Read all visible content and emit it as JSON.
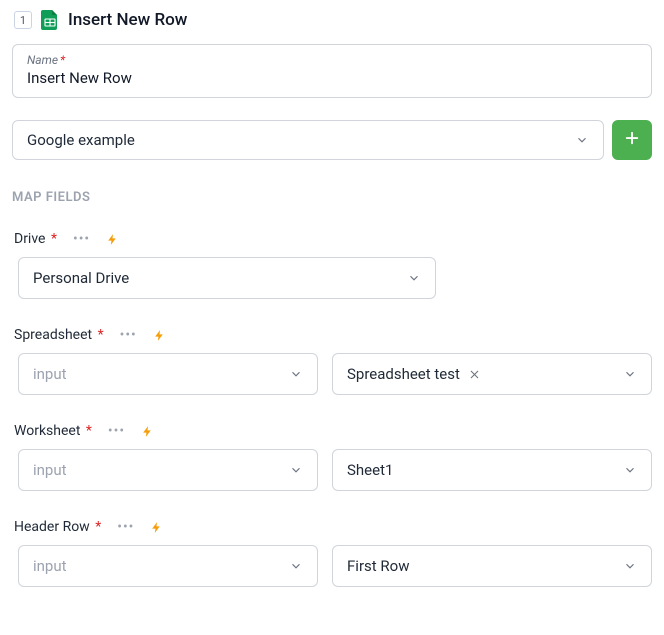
{
  "header": {
    "step_number": "1",
    "title": "Insert New Row"
  },
  "name_field": {
    "label": "Name",
    "value": "Insert New Row"
  },
  "connection": {
    "selected": "Google example"
  },
  "section_heading": "MAP FIELDS",
  "fields": {
    "drive": {
      "label": "Drive",
      "value": "Personal Drive"
    },
    "spreadsheet": {
      "label": "Spreadsheet",
      "input_placeholder": "input",
      "value": "Spreadsheet test"
    },
    "worksheet": {
      "label": "Worksheet",
      "input_placeholder": "input",
      "value": "Sheet1"
    },
    "header_row": {
      "label": "Header Row",
      "input_placeholder": "input",
      "value": "First Row"
    }
  }
}
